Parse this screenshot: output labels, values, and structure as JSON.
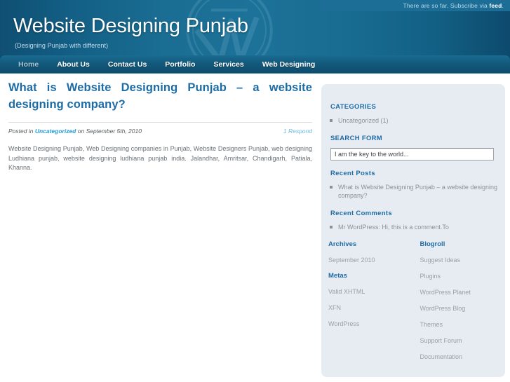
{
  "header": {
    "subscribe_text": "There are so far. Subscribe via ",
    "feed_label": "feed",
    "feed_suffix": ".",
    "site_title": "Website Designing Punjab",
    "tagline": "(Designing Punjab with different)",
    "logo_icon": "wordpress-logo-watermark",
    "accent_color": "#1d7299"
  },
  "nav": {
    "items": [
      {
        "label": "Home",
        "current": true
      },
      {
        "label": "About Us",
        "current": false
      },
      {
        "label": "Contact Us",
        "current": false
      },
      {
        "label": "Portfolio",
        "current": false
      },
      {
        "label": "Services",
        "current": false
      },
      {
        "label": "Web Designing",
        "current": false
      }
    ]
  },
  "post": {
    "title": "What is Website Designing Punjab – a website designing company?",
    "meta_prefix": "Posted in ",
    "meta_category": "Uncategorized",
    "meta_date": " on September 5th, 2010",
    "respond_label": "1 Respond",
    "body": "Website Designing Punjab, Web Designing companies in Punjab, Website Designers Punjab, web designing Ludhiana punjab,   website designing ludhiana punjab india. Jalandhar, Amritsar, Chandigarh, Patiala, Khanna."
  },
  "sidebar": {
    "categories": {
      "heading": "CATEGORIES",
      "items": [
        {
          "label": "Uncategorized (1)"
        }
      ]
    },
    "search": {
      "heading": "SEARCH FORM",
      "value": "I am the key to the world...",
      "placeholder": "I am the key to the world..."
    },
    "recent_posts": {
      "heading": "Recent Posts",
      "items": [
        {
          "label": "What is Website Designing Punjab – a website designing company?"
        }
      ]
    },
    "recent_comments": {
      "heading": "Recent Comments",
      "items": [
        {
          "label": "Mr WordPress: Hi, this is a comment.To"
        }
      ]
    },
    "archives": {
      "heading": "Archives",
      "items": [
        {
          "label": "September 2010"
        }
      ]
    },
    "metas": {
      "heading": "Metas",
      "items": [
        {
          "label": "Valid XHTML"
        },
        {
          "label": "XFN"
        },
        {
          "label": "WordPress"
        }
      ]
    },
    "blogroll": {
      "heading": "Blogroll",
      "items": [
        {
          "label": "Suggest Ideas"
        },
        {
          "label": "Plugins"
        },
        {
          "label": "WordPress Planet"
        },
        {
          "label": "WordPress Blog"
        },
        {
          "label": "Themes"
        },
        {
          "label": "Support Forum"
        },
        {
          "label": "Documentation"
        }
      ]
    }
  }
}
